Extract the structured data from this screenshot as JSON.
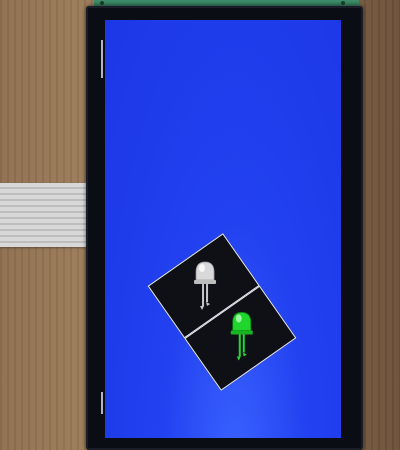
{
  "scene": {
    "description_colors": {
      "screen_blue": "#1f3ae8",
      "led_off": "#d9d9d9",
      "led_on": "#22d82e",
      "panel_bg": "#0f1016"
    },
    "icons": {
      "led_top": "led-off-icon",
      "led_bottom": "led-green-on-icon"
    }
  }
}
